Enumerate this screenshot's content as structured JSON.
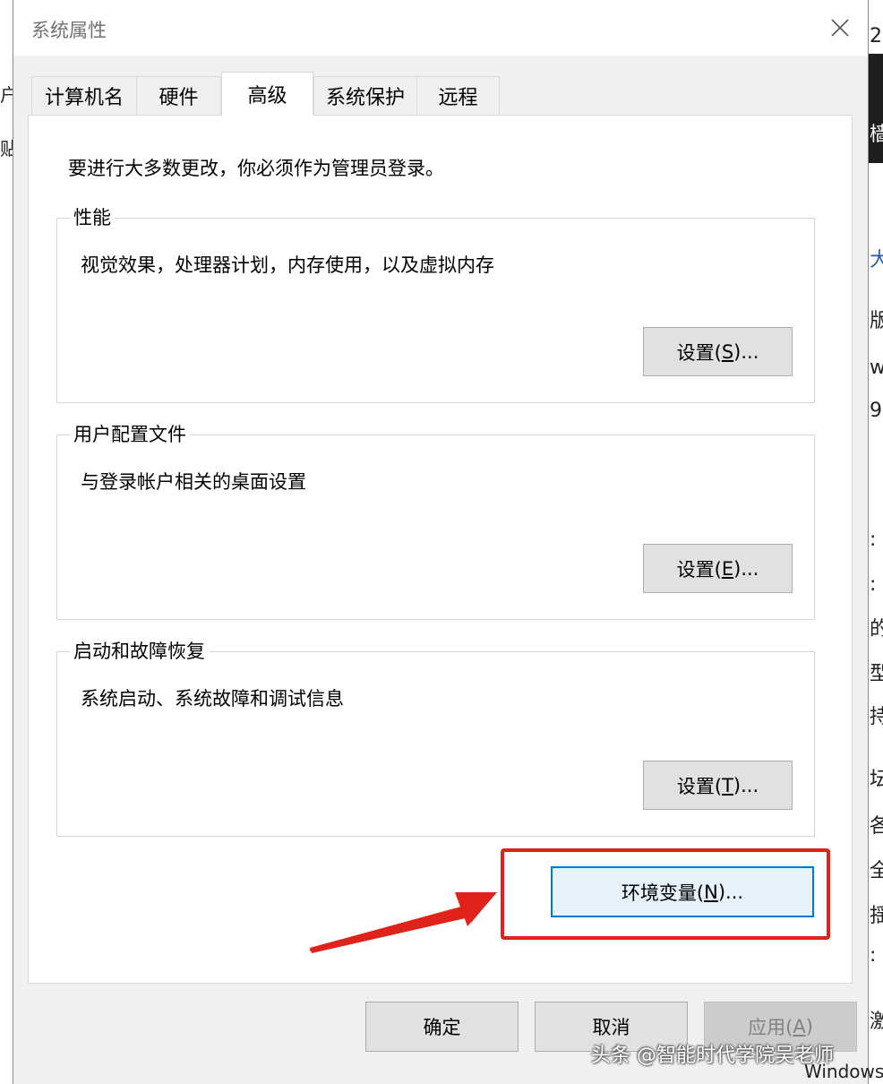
{
  "window": {
    "title": "系统属性"
  },
  "tabs": [
    {
      "label": "计算机名",
      "active": false
    },
    {
      "label": "硬件",
      "active": false
    },
    {
      "label": "高级",
      "active": true
    },
    {
      "label": "系统保护",
      "active": false
    },
    {
      "label": "远程",
      "active": false
    }
  ],
  "advanced": {
    "notice": "要进行大多数更改，你必须作为管理员登录。",
    "performance": {
      "title": "性能",
      "description": "视觉效果，处理器计划，内存使用，以及虚拟内存",
      "button_prefix": "设置(",
      "button_key": "S",
      "button_suffix": ")..."
    },
    "user_profiles": {
      "title": "用户配置文件",
      "description": "与登录帐户相关的桌面设置",
      "button_prefix": "设置(",
      "button_key": "E",
      "button_suffix": ")..."
    },
    "startup_recovery": {
      "title": "启动和故障恢复",
      "description": "系统启动、系统故障和调试信息",
      "button_prefix": "设置(",
      "button_key": "T",
      "button_suffix": ")..."
    },
    "env_vars": {
      "prefix": "环境变量(",
      "key": "N",
      "suffix": ")..."
    }
  },
  "footer": {
    "ok": "确定",
    "cancel": "取消",
    "apply_prefix": "应用(",
    "apply_key": "A",
    "apply_suffix": ")",
    "apply_enabled": false
  },
  "overlay": {
    "watermark": "头条 @智能时代学院吴老师",
    "highlight_color": "#e0231a"
  },
  "background": {
    "left_fragments": [
      "户",
      "贴"
    ],
    "right_fragments": [
      "2",
      "樯",
      "大",
      "版",
      "w",
      "9",
      ":",
      ":",
      "的",
      "型",
      "持",
      "坛",
      "各",
      "全",
      "揺",
      ":",
      "激"
    ],
    "bottom_fragment": "Windows"
  },
  "icons": {
    "close": "close-icon",
    "arrow": "arrow-annotation"
  }
}
